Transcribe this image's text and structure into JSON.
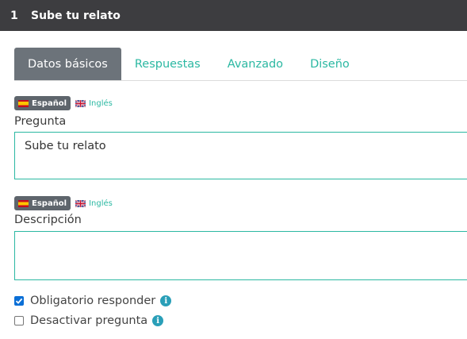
{
  "header": {
    "number": "1",
    "title": "Sube tu relato"
  },
  "tabs": [
    {
      "label": "Datos básicos",
      "active": true
    },
    {
      "label": "Respuestas",
      "active": false
    },
    {
      "label": "Avanzado",
      "active": false
    },
    {
      "label": "Diseño",
      "active": false
    }
  ],
  "question": {
    "lang_active": "Español",
    "lang_alt": "Inglés",
    "label": "Pregunta",
    "value": "Sube tu relato"
  },
  "description": {
    "lang_active": "Español",
    "lang_alt": "Inglés",
    "label": "Descripción",
    "value": ""
  },
  "options": {
    "required_label": "Obligatorio responder",
    "required_checked": true,
    "disable_label": "Desactivar pregunta",
    "disable_checked": false
  },
  "icons": {
    "info": "info-icon",
    "flag_es": "flag-spain-icon",
    "flag_uk": "flag-uk-icon",
    "check": "checkmark-icon"
  },
  "colors": {
    "header_bg": "#3d3d40",
    "accent": "#2bb8a2",
    "active_tab": "#6c737a",
    "checkbox": "#0b6fd6",
    "info": "#2a9fb8"
  }
}
